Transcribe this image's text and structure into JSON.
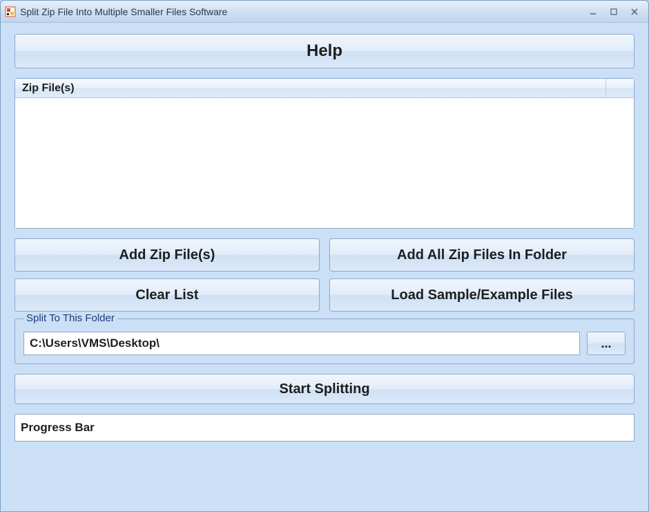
{
  "window": {
    "title": "Split Zip File Into Multiple Smaller Files Software"
  },
  "buttons": {
    "help": "Help",
    "add_zip": "Add Zip File(s)",
    "add_all": "Add All Zip Files In Folder",
    "clear": "Clear List",
    "load_sample": "Load Sample/Example Files",
    "browse": "...",
    "start": "Start Splitting"
  },
  "list": {
    "column_header": "Zip File(s)"
  },
  "group": {
    "split_folder_title": "Split To This Folder"
  },
  "fields": {
    "output_path": "C:\\Users\\VMS\\Desktop\\"
  },
  "progress": {
    "label": "Progress Bar"
  }
}
